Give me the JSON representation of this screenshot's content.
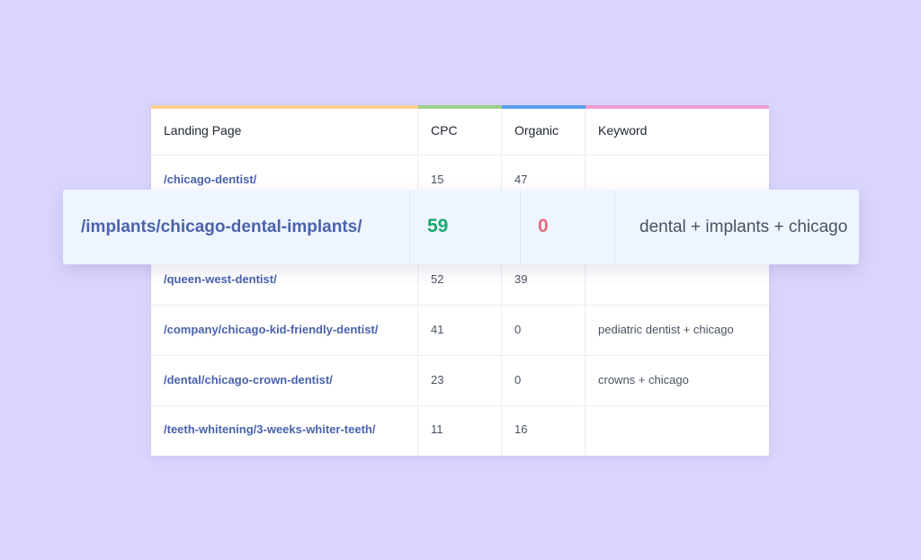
{
  "table": {
    "columns": [
      {
        "label": "Landing Page",
        "accent": "#f7cd8f"
      },
      {
        "label": "CPC",
        "accent": "#9ccf8b"
      },
      {
        "label": "Organic",
        "accent": "#5b9cf0"
      },
      {
        "label": "Keyword",
        "accent": "#f19bd3"
      }
    ],
    "rows": [
      {
        "landing_page": "/chicago-dentist/",
        "cpc": "15",
        "organic": "47",
        "keyword": ""
      },
      {
        "landing_page": "/queen-west-dentist/",
        "cpc": "52",
        "organic": "39",
        "keyword": ""
      },
      {
        "landing_page": "/company/chicago-kid-friendly-dentist/",
        "cpc": "41",
        "organic": "0",
        "keyword": "pediatric dentist + chicago"
      },
      {
        "landing_page": "/dental/chicago-crown-dentist/",
        "cpc": "23",
        "organic": "0",
        "keyword": "crowns + chicago"
      },
      {
        "landing_page": "/teeth-whitening/3-weeks-whiter-teeth/",
        "cpc": "11",
        "organic": "16",
        "keyword": ""
      }
    ]
  },
  "highlight_row": {
    "landing_page": "/implants/chicago-dental-implants/",
    "cpc": "59",
    "organic": "0",
    "keyword": "dental + implants + chicago",
    "cpc_color": "#1aa96f",
    "organic_color": "#e86b7e"
  },
  "colors": {
    "background": "#dad5fd",
    "link": "#4a62ac",
    "highlight_background": "#eff5fe"
  }
}
